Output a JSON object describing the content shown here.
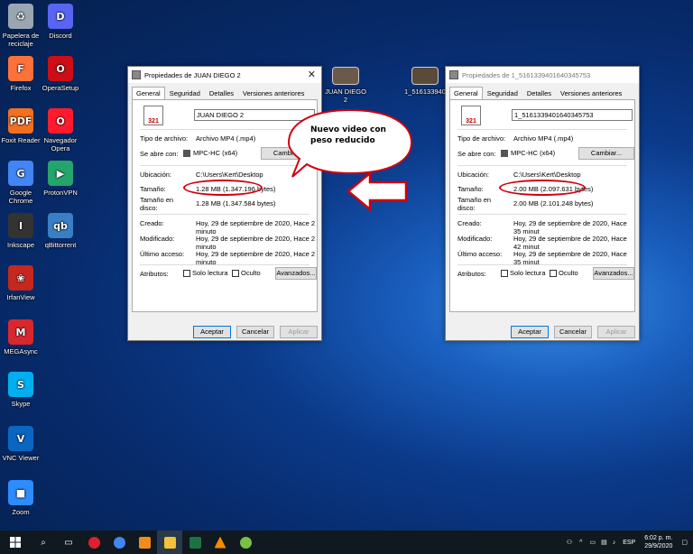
{
  "desktop_icons": [
    {
      "label": "Papelera de reciclaje",
      "glyph": "♻",
      "color": "#9aa7b3"
    },
    {
      "label": "Discord",
      "glyph": "D",
      "color": "#5865f2"
    },
    {
      "label": "Firefox",
      "glyph": "F",
      "color": "#ff7139"
    },
    {
      "label": "OperaSetup",
      "glyph": "O",
      "color": "#cc0f16"
    },
    {
      "label": "Foxit Reader",
      "glyph": "PDF",
      "color": "#f37021"
    },
    {
      "label": "Navegador Opera",
      "glyph": "O",
      "color": "#ff1b2d"
    },
    {
      "label": "Google Chrome",
      "glyph": "G",
      "color": "#4285f4"
    },
    {
      "label": "ProtonVPN",
      "glyph": "▶",
      "color": "#25a46b"
    },
    {
      "label": "Inkscape",
      "glyph": "I",
      "color": "#333333"
    },
    {
      "label": "qBittorrent",
      "glyph": "qb",
      "color": "#3a7fc4"
    },
    {
      "label": "IrfanView",
      "glyph": "❀",
      "color": "#c4281f"
    },
    {
      "label": "MEGAsync",
      "glyph": "M",
      "color": "#d9272e"
    },
    {
      "label": "Skype",
      "glyph": "S",
      "color": "#00aff0"
    },
    {
      "label": "VNC Viewer",
      "glyph": "V",
      "color": "#0b66c2"
    },
    {
      "label": "Zoom",
      "glyph": "■",
      "color": "#2d8cff"
    }
  ],
  "video_icons": [
    {
      "label": "JUAN DIEGO 2"
    },
    {
      "label": "1_516133940..."
    }
  ],
  "dialogs": [
    {
      "title": "Propiedades de JUAN DIEGO 2",
      "tabs": [
        "General",
        "Seguridad",
        "Detalles",
        "Versiones anteriores"
      ],
      "filename": "JUAN DIEGO 2",
      "tipo_label": "Tipo de archivo:",
      "tipo_val": "Archivo MP4 (.mp4)",
      "abre_label": "Se abre con:",
      "abre_val": "MPC-HC (x64)",
      "cambiar": "Cambiar...",
      "ubic_label": "Ubicación:",
      "ubic_val": "C:\\Users\\Kert\\Desktop",
      "tam_label": "Tamaño:",
      "tam_val": "1.28 MB (1.347.196 bytes)",
      "tamd_label": "Tamaño en disco:",
      "tamd_val": "1.28 MB (1.347.584 bytes)",
      "creado_label": "Creado:",
      "creado_val": "Hoy, 29 de septiembre de 2020, Hace 2 minuto",
      "mod_label": "Modificado:",
      "mod_val": "Hoy, 29 de septiembre de 2020, Hace 2 minuto",
      "acc_label": "Último acceso:",
      "acc_val": "Hoy, 29 de septiembre de 2020, Hace 2 minuto",
      "attr_label": "Atributos:",
      "solo": "Solo lectura",
      "oculto": "Oculto",
      "avanz": "Avanzados...",
      "aceptar": "Aceptar",
      "cancelar": "Cancelar",
      "aplicar": "Aplicar"
    },
    {
      "title": "Propiedades de 1_5161339401640345753",
      "tabs": [
        "General",
        "Seguridad",
        "Detalles",
        "Versiones anteriores"
      ],
      "filename": "1_5161339401640345753",
      "tipo_label": "Tipo de archivo:",
      "tipo_val": "Archivo MP4 (.mp4)",
      "abre_label": "Se abre con:",
      "abre_val": "MPC-HC (x64)",
      "cambiar": "Cambiar...",
      "ubic_label": "Ubicación:",
      "ubic_val": "C:\\Users\\Kert\\Desktop",
      "tam_label": "Tamaño:",
      "tam_val": "2.00 MB (2.097.631 bytes)",
      "tamd_label": "Tamaño en disco:",
      "tamd_val": "2.00 MB (2.101.248 bytes)",
      "creado_label": "Creado:",
      "creado_val": "Hoy, 29 de septiembre de 2020, Hace 35 minut",
      "mod_label": "Modificado:",
      "mod_val": "Hoy, 29 de septiembre de 2020, Hace 42 minut",
      "acc_label": "Último acceso:",
      "acc_val": "Hoy, 29 de septiembre de 2020, Hace 35 minut",
      "attr_label": "Atributos:",
      "solo": "Solo lectura",
      "oculto": "Oculto",
      "avanz": "Avanzados...",
      "aceptar": "Aceptar",
      "cancelar": "Cancelar",
      "aplicar": "Aplicar"
    }
  ],
  "callout": "Nuevo video con peso reducido",
  "taskbar": {
    "time": "6:02 p. m.",
    "date": "29/9/2020",
    "lang": "ESP"
  }
}
